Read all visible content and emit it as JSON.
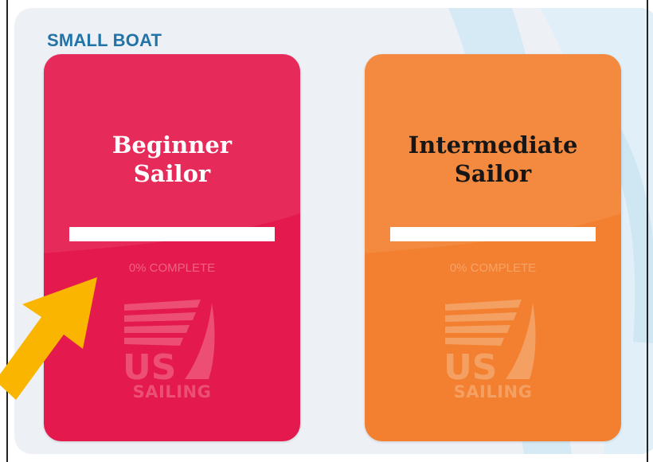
{
  "section": {
    "title": "SMALL BOAT"
  },
  "cards": [
    {
      "title_line1": "Beginner",
      "title_line2": "Sailor",
      "progress_percent": 0,
      "progress_label": "0% COMPLETE",
      "logo_text": "SAILING",
      "logo_icon": "us-sailing-logo-icon",
      "color": "#e4194d"
    },
    {
      "title_line1": "Intermediate",
      "title_line2": "Sailor",
      "progress_percent": 0,
      "progress_label": "0% COMPLETE",
      "logo_text": "SAILING",
      "logo_icon": "us-sailing-logo-icon",
      "color": "#f28030"
    }
  ],
  "annotation": {
    "arrow_color": "#f9b500"
  }
}
